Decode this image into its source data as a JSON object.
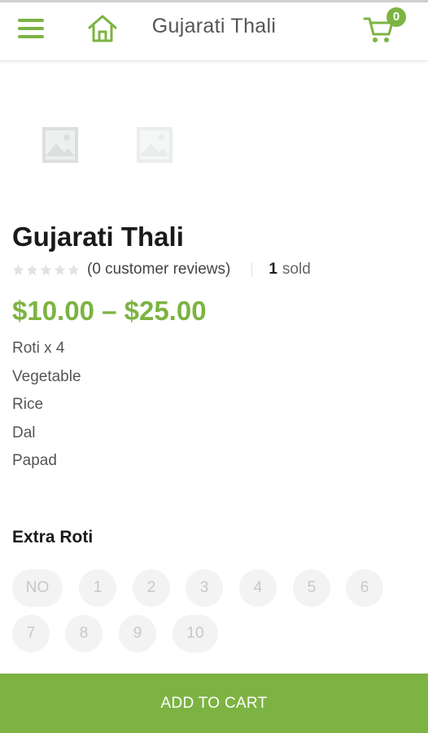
{
  "header": {
    "title": "Gujarati Thali",
    "cart_count": "0"
  },
  "colors": {
    "accent": "#7cb342",
    "text": "#1a1a1a",
    "muted": "#555555"
  },
  "icons": [
    "menu-icon",
    "home-icon",
    "cart-icon",
    "image-placeholder-icon",
    "star-icon"
  ],
  "product": {
    "title": "Gujarati Thali",
    "rating": 0,
    "reviews_text": "(0 customer reviews)",
    "sold_count": "1",
    "sold_label": "sold",
    "price": "$10.00 – $25.00",
    "description": [
      "Roti x 4",
      "Vegetable",
      "Rice",
      "Dal",
      "Papad"
    ]
  },
  "extra": {
    "label": "Extra Roti",
    "options": [
      "NO",
      "1",
      "2",
      "3",
      "4",
      "5",
      "6",
      "7",
      "8",
      "9",
      "10"
    ]
  },
  "actions": {
    "add_to_cart": "ADD TO CART"
  }
}
